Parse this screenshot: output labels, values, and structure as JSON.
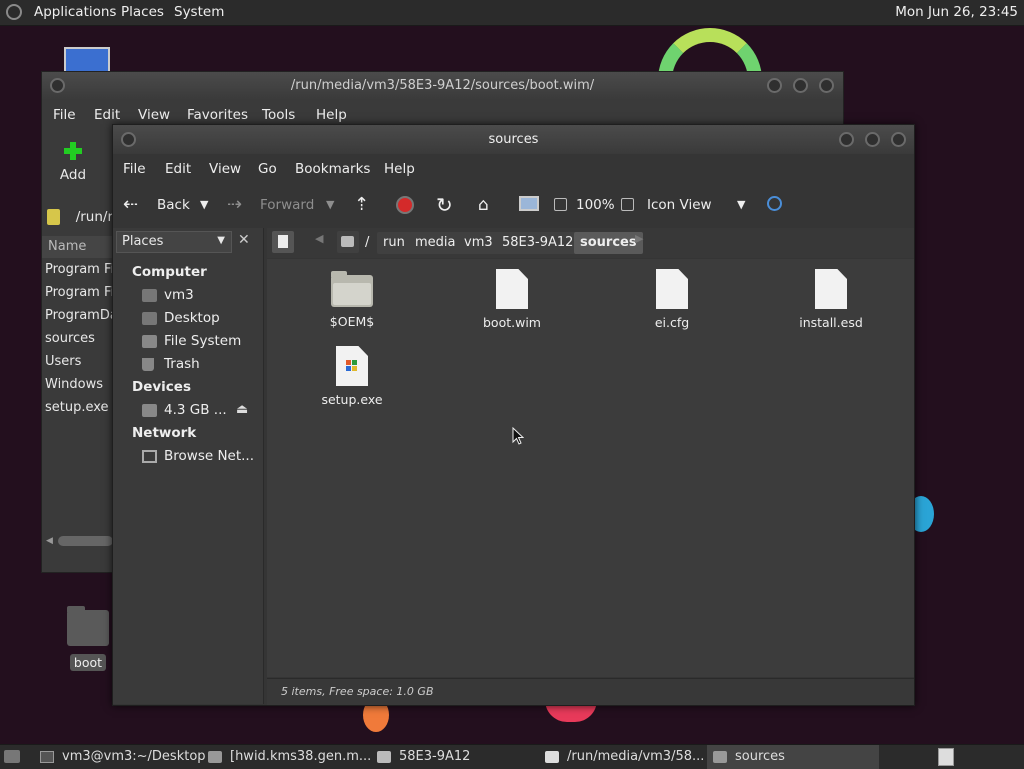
{
  "top_panel": {
    "menus": [
      "Applications",
      "Places",
      "System"
    ],
    "clock": "Mon Jun 26, 23:45"
  },
  "desktop": {
    "icon_label": "boot"
  },
  "back_window": {
    "title": "/run/media/vm3/58E3-9A12/sources/boot.wim/",
    "menus": [
      "File",
      "Edit",
      "View",
      "Favorites",
      "Tools",
      "Help"
    ],
    "add_label": "Add",
    "path_text": "/run/r",
    "column_name": "Name",
    "rows": [
      "Program Fi",
      "Program Fi",
      "ProgramDa",
      "sources",
      "Users",
      "Windows",
      "setup.exe"
    ]
  },
  "front_window": {
    "title": "sources",
    "menus": [
      "File",
      "Edit",
      "View",
      "Go",
      "Bookmarks",
      "Help"
    ],
    "toolbar": {
      "back": "Back",
      "forward": "Forward",
      "zoom": "100%",
      "view_mode": "Icon View"
    },
    "sidebar": {
      "header": "Places",
      "sections": [
        {
          "title": "Computer",
          "items": [
            "vm3",
            "Desktop",
            "File System",
            "Trash"
          ]
        },
        {
          "title": "Devices",
          "items": [
            "4.3 GB ..."
          ]
        },
        {
          "title": "Network",
          "items": [
            "Browse Net..."
          ]
        }
      ]
    },
    "breadcrumbs": [
      "/",
      "run",
      "media",
      "vm3",
      "58E3-9A12",
      "sources"
    ],
    "files": [
      {
        "name": "$OEM$",
        "type": "folder"
      },
      {
        "name": "boot.wim",
        "type": "document"
      },
      {
        "name": "ei.cfg",
        "type": "document"
      },
      {
        "name": "install.esd",
        "type": "document"
      },
      {
        "name": "setup.exe",
        "type": "executable"
      }
    ],
    "status": "5 items, Free space: 1.0 GB"
  },
  "taskbar": {
    "items": [
      "vm3@vm3:~/Desktop",
      "[hwid.kms38.gen.m...",
      "58E3-9A12",
      "/run/media/vm3/58...",
      "sources"
    ]
  },
  "colors": {
    "selected_crumb": "#5a5a5a",
    "add_icon": "#22cc22",
    "stop_icon": "#d42a2a"
  }
}
